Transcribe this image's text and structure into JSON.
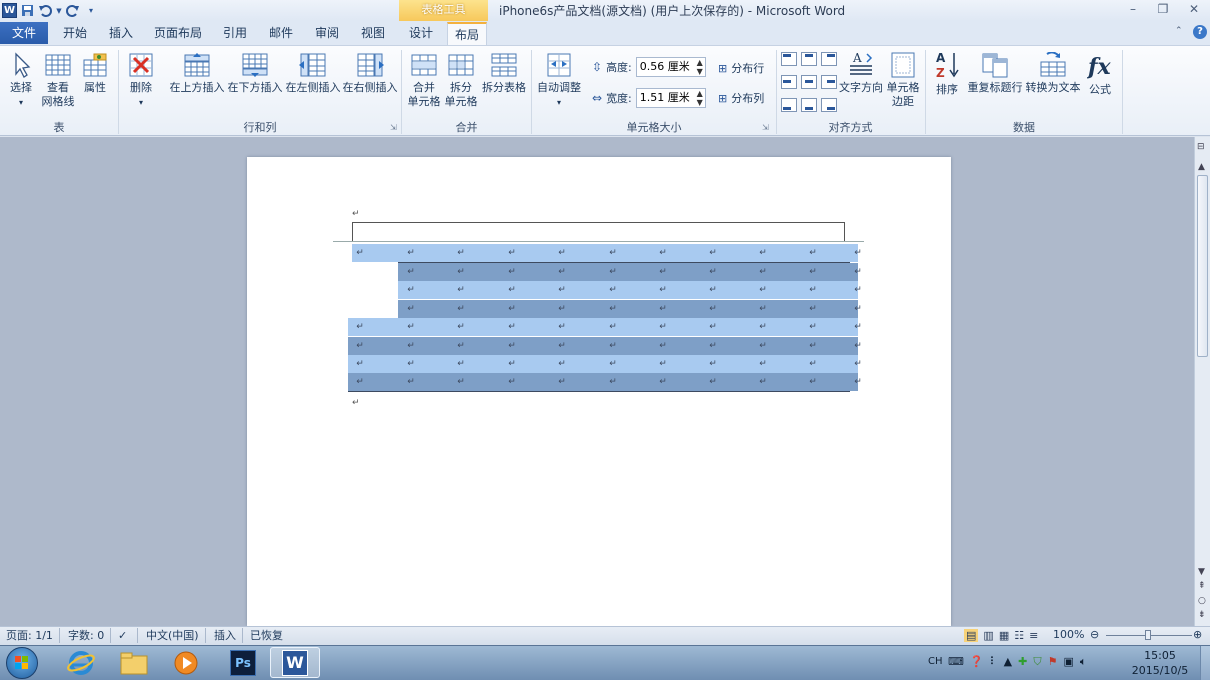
{
  "window": {
    "context_tab": "表格工具",
    "title": "iPhone6s产品文档(源文档) (用户上次保存的) - Microsoft Word",
    "app_icon": "W",
    "qat_icons": [
      "word-app-icon",
      "save-icon",
      "undo-icon",
      "redo-icon",
      "customize-qat-icon"
    ]
  },
  "tabs": {
    "file": "文件",
    "items": [
      "开始",
      "插入",
      "页面布局",
      "引用",
      "邮件",
      "审阅",
      "视图",
      "设计",
      "布局"
    ],
    "active": "布局"
  },
  "ribbon": {
    "groups": {
      "table": {
        "label": "表",
        "select": "选择",
        "gridlines_1": "查看",
        "gridlines_2": "网格线",
        "properties": "属性"
      },
      "rows_cols": {
        "label": "行和列",
        "delete": "删除",
        "insert_above": "在上方插入",
        "insert_below": "在下方插入",
        "insert_left": "在左侧插入",
        "insert_right": "在右侧插入"
      },
      "merge": {
        "label": "合并",
        "merge_1": "合并",
        "merge_2": "单元格",
        "split_1": "拆分",
        "split_2": "单元格",
        "split_table": "拆分表格"
      },
      "cell_size": {
        "label": "单元格大小",
        "autofit": "自动调整",
        "height_label": "高度:",
        "height_value": "0.56 厘米",
        "width_label": "宽度:",
        "width_value": "1.51 厘米",
        "dist_rows": "分布行",
        "dist_cols": "分布列"
      },
      "alignment": {
        "label": "对齐方式",
        "text_dir": "文字方向",
        "margins_1": "单元格",
        "margins_2": "边距"
      },
      "data": {
        "label": "数据",
        "sort": "排序",
        "repeat_header": "重复标题行",
        "convert": "转换为文本",
        "formula": "公式"
      }
    }
  },
  "document": {
    "para_mark": "↵"
  },
  "statusbar": {
    "page": "页面: 1/1",
    "words": "字数: 0",
    "language": "中文(中国)",
    "mode": "插入",
    "recovered": "已恢复",
    "zoom": "100%"
  },
  "taskbar": {
    "tray_lang": "CH",
    "time": "15:05",
    "date": "2015/10/5"
  },
  "colors": {
    "light_row": "#a8caf0",
    "dark_row": "#7e9fc7",
    "accent": "#2b579a"
  }
}
